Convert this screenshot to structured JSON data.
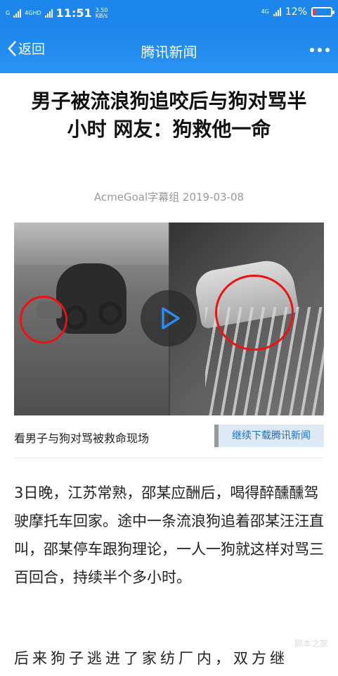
{
  "status_bar": {
    "net_type_1": "G",
    "net_type_2": "4GHD",
    "time": "11:51",
    "speed_value": "3.50",
    "speed_unit": "KB/s",
    "net_type_right": "4G",
    "battery": "12%",
    "battery_fraction": 0.12,
    "battery_color": "#ff3b30"
  },
  "nav": {
    "back_label": "返回",
    "title": "腾讯新闻",
    "menu_icon": "more-dots-icon",
    "bg_color": "#1d86ec"
  },
  "article": {
    "title": "男子被流浪狗追咬后与狗对骂半小时 网友：狗救他一命",
    "source_date": "AcmeGoal字幕组 2019-03-08",
    "video_caption": "看男子与狗对骂被救命现场",
    "download_button": "继续下载腾讯新闻",
    "paragraphs": [
      "3日晚，江苏常熟，邵某应酬后，喝得醉醺醺驾驶摩托车回家。途中一条流浪狗追着邵某汪汪直叫，邵某停车跟狗理论，一人一狗就这样对骂三百回合，持续半个多小时。",
      "后来狗子逃进了家纺厂内，双方继"
    ]
  },
  "watermark": "脚本之家"
}
